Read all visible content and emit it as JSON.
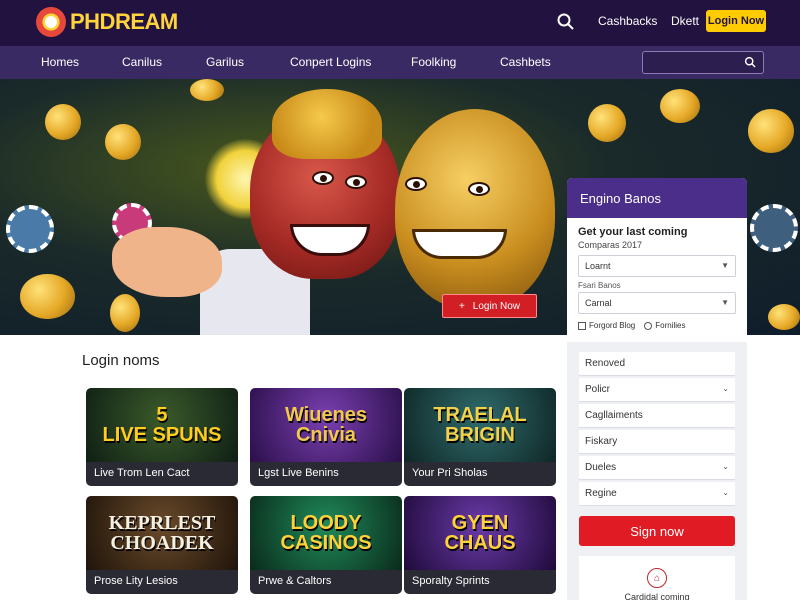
{
  "brand": {
    "name": "PHDREAM"
  },
  "topbar": {
    "links": [
      "Cashbacks",
      "Dkett"
    ],
    "cta_label": "Login Now",
    "search_icon": "search-icon"
  },
  "nav": {
    "items": [
      "Homes",
      "Canilus",
      "Garilus",
      "Conpert Logins",
      "Foolking",
      "Cashbets"
    ]
  },
  "hero": {
    "cta_label": "Login Now",
    "cta_icon": "+"
  },
  "login_panel": {
    "heading": "Engino Banos",
    "title": "Get your last coming",
    "subtitle": "Comparas 2017",
    "select1_value": "Loarnt",
    "field_label": "Fsari Banos",
    "select2_value": "Carnal",
    "checkbox_label": "Forgord Blog",
    "radio_label": "Fornilies",
    "menu": [
      "Renoved",
      "Policr",
      "Cagllaiments",
      "Fiskary",
      "Dueles",
      "Regine"
    ],
    "signup_label": "Sign now",
    "bottom_text": "Cardidal coming"
  },
  "games": {
    "section_title": "Login noms",
    "cards": [
      {
        "art": "5\nLIVE SPUNS",
        "label": "Live Trom Len Cact",
        "bg": "#1a3a2a",
        "fg": "#ffcc22"
      },
      {
        "art": "Wiuenes\nCnivia",
        "label": "Lgst Live Benins",
        "bg": "#4a1f7a",
        "fg": "#f2c94c"
      },
      {
        "art": "TRAELAL\nBRIGIN",
        "label": "Your Pri Sholas",
        "bg": "#1e4a4a",
        "fg": "#f2d24a"
      },
      {
        "art": "KEPRLEST\nCHOADEK",
        "label": "Prose Lity Lesios",
        "bg": "#3a2a1a",
        "fg": "#f5f0e0"
      },
      {
        "art": "LOODY\nCASINOS",
        "label": "Prwe & Caltors",
        "bg": "#0f5a3a",
        "fg": "#ffd23a"
      },
      {
        "art": "GYEN\nCHAUS",
        "label": "Sporalty Sprints",
        "bg": "#3b1a6a",
        "fg": "#ffd23a"
      }
    ]
  },
  "colors": {
    "topbar": "#22123f",
    "nav": "#3a2a63",
    "accent_yellow": "#ffcc00",
    "accent_red": "#e11b24",
    "panel_head": "#4b2d8a"
  }
}
